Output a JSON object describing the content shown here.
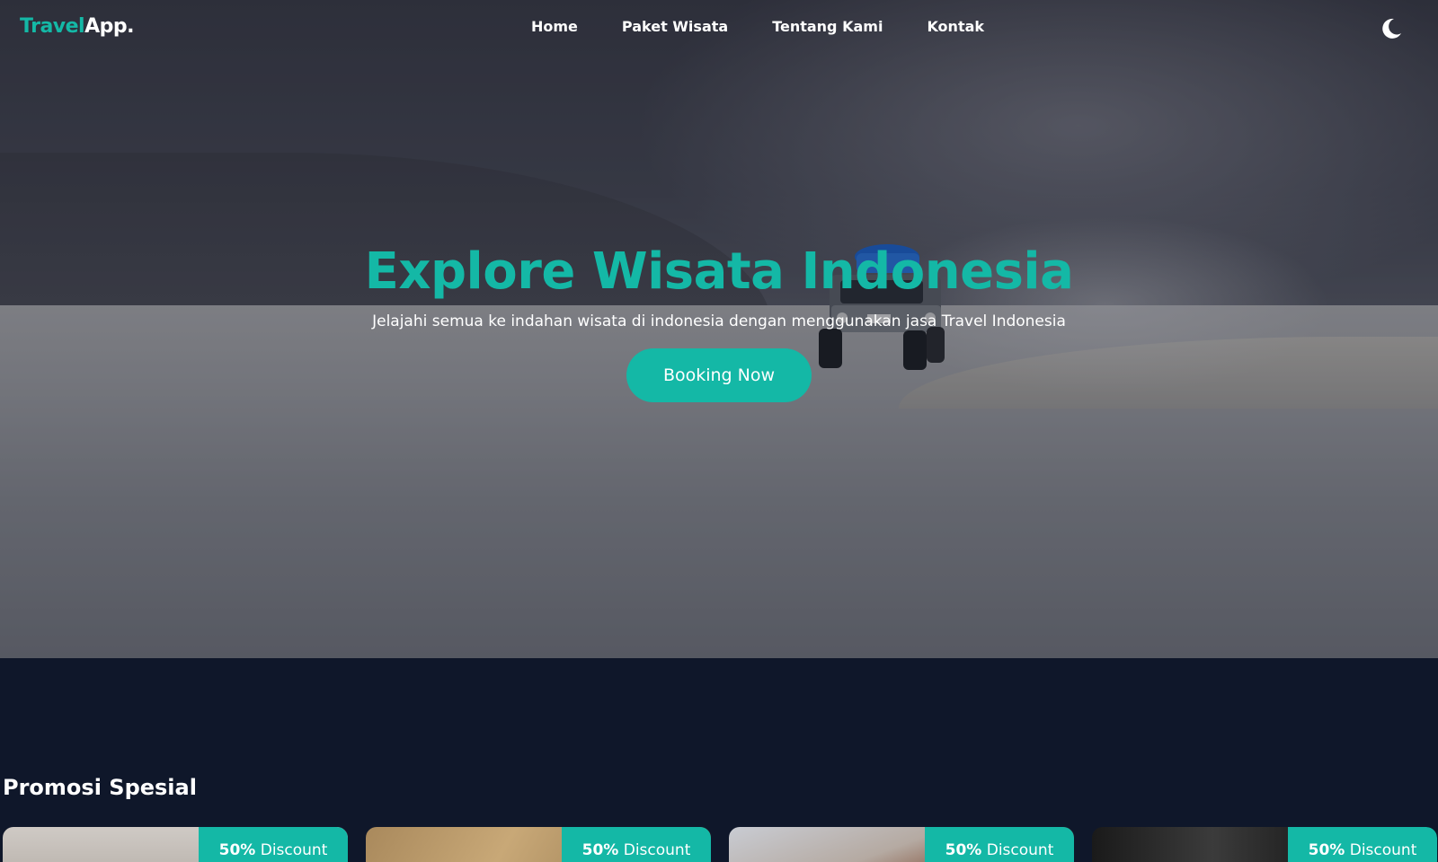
{
  "brand": {
    "part1": "Travel",
    "part2": "App."
  },
  "nav": {
    "items": [
      "Home",
      "Paket Wisata",
      "Tentang Kami",
      "Kontak"
    ]
  },
  "hero": {
    "title": "Explore Wisata Indonesia",
    "subtitle": "Jelajahi semua ke indahan wisata di indonesia dengan menggunakan jasa Travel Indonesia",
    "cta": "Booking Now"
  },
  "promo": {
    "title": "Promosi Spesial",
    "cards": [
      {
        "discount": "50%",
        "label": "Discount"
      },
      {
        "discount": "50%",
        "label": "Discount"
      },
      {
        "discount": "50%",
        "label": "Discount"
      },
      {
        "discount": "50%",
        "label": "Discount"
      }
    ]
  },
  "colors": {
    "accent": "#14b8a6",
    "background": "#0f172a"
  },
  "icons": {
    "theme_toggle": "moon-icon"
  }
}
